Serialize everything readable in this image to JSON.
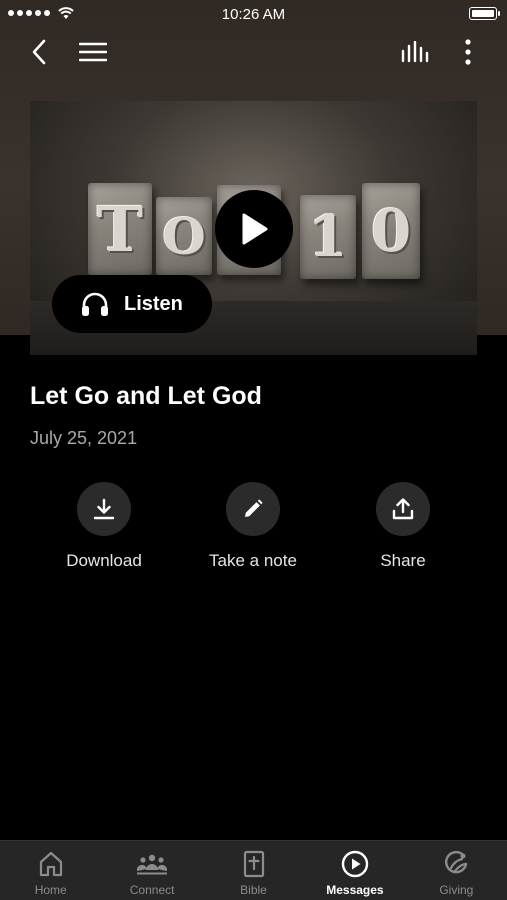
{
  "status_bar": {
    "time": "10:26 AM"
  },
  "nav": {
    "back_icon": "chevron-left-icon",
    "menu_icon": "hamburger-menu-icon",
    "audio_icon": "equalizer-icon",
    "more_icon": "more-vertical-icon"
  },
  "media": {
    "artwork_letters": [
      "T",
      "O",
      "P",
      "1",
      "0"
    ],
    "play_icon": "play-icon",
    "listen_label": "Listen",
    "listen_icon": "headphones-icon"
  },
  "message": {
    "title": "Let Go and Let God",
    "date": "July 25, 2021"
  },
  "actions": [
    {
      "label": "Download",
      "icon": "download-icon"
    },
    {
      "label": "Take a note",
      "icon": "pencil-icon"
    },
    {
      "label": "Share",
      "icon": "share-icon"
    }
  ],
  "tabs": [
    {
      "label": "Home",
      "icon": "home-icon"
    },
    {
      "label": "Connect",
      "icon": "people-icon"
    },
    {
      "label": "Bible",
      "icon": "bible-icon"
    },
    {
      "label": "Messages",
      "icon": "play-circle-icon",
      "active": true
    },
    {
      "label": "Giving",
      "icon": "giving-icon"
    }
  ],
  "colors": {
    "background": "#000000",
    "header_brown": "#3a322c",
    "tab_bar": "#262626",
    "action_circle": "#2b2b2b",
    "secondary_text": "#a9a9a9"
  }
}
